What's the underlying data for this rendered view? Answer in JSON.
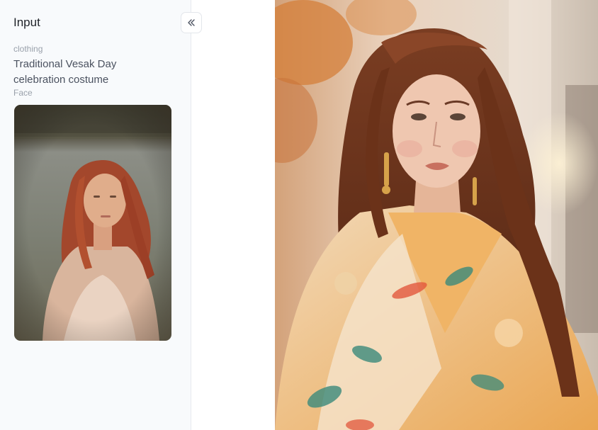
{
  "input_panel": {
    "title": "Input",
    "clothing": {
      "label": "clothing",
      "value": "Traditional Vesak Day celebration costume"
    },
    "face": {
      "label": "Face"
    }
  },
  "icons": {
    "collapse": "double-chevron-left-icon"
  },
  "colors": {
    "panel_bg": "#f8fafc",
    "title_text": "#1f2329",
    "label_text": "#9aa1ab",
    "value_text": "#4b5260"
  }
}
